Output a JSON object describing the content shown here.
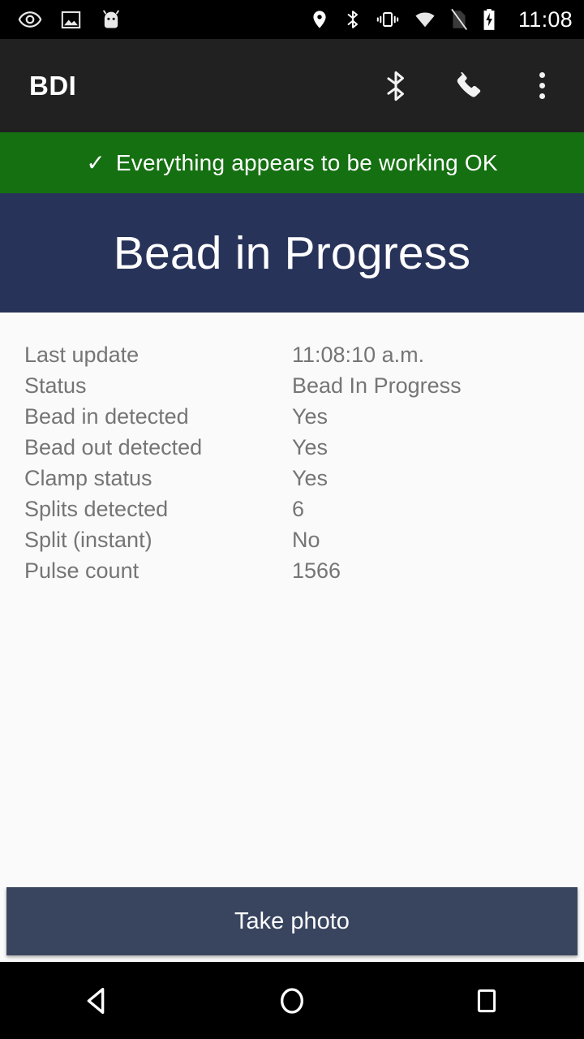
{
  "statusbar": {
    "time": "11:08",
    "left_icons": [
      {
        "name": "eye-care-icon"
      },
      {
        "name": "screenshot-image-icon"
      },
      {
        "name": "android-robot-icon"
      }
    ],
    "right_icons": [
      {
        "name": "location-pin-icon"
      },
      {
        "name": "bluetooth-icon"
      },
      {
        "name": "vibrate-mode-icon"
      },
      {
        "name": "wifi-icon"
      },
      {
        "name": "no-sim-card-icon"
      },
      {
        "name": "battery-charging-icon"
      }
    ]
  },
  "appbar": {
    "title": "BDI",
    "actions": [
      {
        "name": "bluetooth-icon"
      },
      {
        "name": "phone-icon"
      },
      {
        "name": "overflow-menu-icon"
      }
    ]
  },
  "banner": {
    "check_glyph": "✓",
    "message": "Everything appears to be working OK",
    "color": "#157012"
  },
  "hero": {
    "title": "Bead in Progress",
    "color": "#28335A"
  },
  "details": {
    "rows": [
      {
        "label": "Last update",
        "value": "11:08:10 a.m."
      },
      {
        "label": "Status",
        "value": "Bead In Progress"
      },
      {
        "label": "Bead in detected",
        "value": "Yes"
      },
      {
        "label": "Bead out detected",
        "value": "Yes"
      },
      {
        "label": "Clamp status",
        "value": "Yes"
      },
      {
        "label": "Splits detected",
        "value": "6"
      },
      {
        "label": "Split (instant)",
        "value": "No"
      },
      {
        "label": "Pulse count",
        "value": "1566"
      }
    ]
  },
  "action": {
    "label": "Take photo",
    "color": "#39455F"
  },
  "navbar": {
    "buttons": [
      {
        "name": "back-button"
      },
      {
        "name": "home-button"
      },
      {
        "name": "recents-button"
      }
    ]
  }
}
